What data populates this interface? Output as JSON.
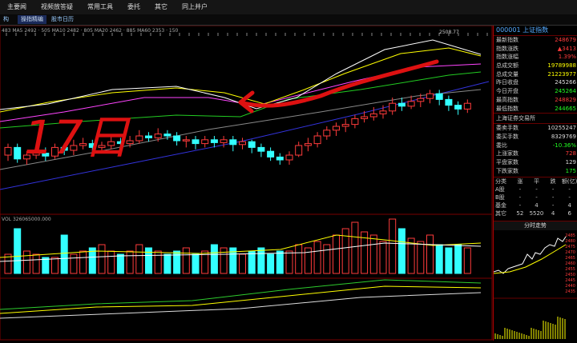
{
  "menubar": {
    "items": [
      "主要闻",
      "视频放答疑",
      "常用工具",
      "委托",
      "其它",
      "同上并户"
    ]
  },
  "tabs": [
    "构",
    "操指精编",
    "股市日历"
  ],
  "chart": {
    "ma_legend": "483 MA5 2492 · 505 MA10 2482 · 805 MA20 2462 · 885 MA60 2353 · 150",
    "price_label": "2508.77",
    "volume_legend": "VOL 326065000.000",
    "annotation": "17日",
    "candles": [
      {
        "o": 60,
        "c": 52,
        "h": 48,
        "l": 66
      },
      {
        "o": 52,
        "c": 64,
        "h": 48,
        "l": 68
      },
      {
        "o": 64,
        "c": 60,
        "h": 56,
        "l": 70
      },
      {
        "o": 60,
        "c": 58,
        "h": 54,
        "l": 64
      },
      {
        "o": 58,
        "c": 61,
        "h": 52,
        "l": 66
      },
      {
        "o": 61,
        "c": 52,
        "h": 48,
        "l": 64
      },
      {
        "o": 52,
        "c": 55,
        "h": 48,
        "l": 60
      },
      {
        "o": 55,
        "c": 50,
        "h": 44,
        "l": 60
      },
      {
        "o": 50,
        "c": 48,
        "h": 42,
        "l": 54
      },
      {
        "o": 48,
        "c": 52,
        "h": 44,
        "l": 58
      },
      {
        "o": 52,
        "c": 50,
        "h": 46,
        "l": 56
      },
      {
        "o": 50,
        "c": 46,
        "h": 40,
        "l": 54
      },
      {
        "o": 46,
        "c": 48,
        "h": 42,
        "l": 52
      },
      {
        "o": 48,
        "c": 45,
        "h": 40,
        "l": 52
      },
      {
        "o": 45,
        "c": 40,
        "h": 34,
        "l": 48
      },
      {
        "o": 40,
        "c": 42,
        "h": 36,
        "l": 46
      },
      {
        "o": 42,
        "c": 38,
        "h": 32,
        "l": 46
      },
      {
        "o": 38,
        "c": 40,
        "h": 34,
        "l": 44
      },
      {
        "o": 40,
        "c": 45,
        "h": 36,
        "l": 50
      },
      {
        "o": 45,
        "c": 44,
        "h": 40,
        "l": 52
      },
      {
        "o": 44,
        "c": 48,
        "h": 40,
        "l": 54
      },
      {
        "o": 48,
        "c": 44,
        "h": 40,
        "l": 52
      },
      {
        "o": 44,
        "c": 47,
        "h": 40,
        "l": 52
      },
      {
        "o": 47,
        "c": 44,
        "h": 40,
        "l": 52
      },
      {
        "o": 44,
        "c": 49,
        "h": 40,
        "l": 56
      },
      {
        "o": 49,
        "c": 46,
        "h": 42,
        "l": 54
      },
      {
        "o": 46,
        "c": 52,
        "h": 44,
        "l": 58
      },
      {
        "o": 52,
        "c": 56,
        "h": 48,
        "l": 62
      },
      {
        "o": 56,
        "c": 62,
        "h": 52,
        "l": 66
      },
      {
        "o": 62,
        "c": 65,
        "h": 58,
        "l": 70
      },
      {
        "o": 65,
        "c": 60,
        "h": 56,
        "l": 70
      },
      {
        "o": 60,
        "c": 50,
        "h": 46,
        "l": 62
      },
      {
        "o": 50,
        "c": 48,
        "h": 42,
        "l": 56
      },
      {
        "o": 48,
        "c": 40,
        "h": 36,
        "l": 52
      },
      {
        "o": 40,
        "c": 34,
        "h": 30,
        "l": 44
      },
      {
        "o": 34,
        "c": 30,
        "h": 26,
        "l": 40
      },
      {
        "o": 30,
        "c": 28,
        "h": 22,
        "l": 36
      },
      {
        "o": 28,
        "c": 22,
        "h": 18,
        "l": 32
      },
      {
        "o": 22,
        "c": 20,
        "h": 14,
        "l": 26
      },
      {
        "o": 20,
        "c": 17,
        "h": 10,
        "l": 24
      },
      {
        "o": 17,
        "c": 14,
        "h": 8,
        "l": 22
      },
      {
        "o": 14,
        "c": 6,
        "h": 0,
        "l": 18
      },
      {
        "o": 6,
        "c": 9,
        "h": 0,
        "l": 14
      },
      {
        "o": 9,
        "c": 4,
        "h": -2,
        "l": 12
      },
      {
        "o": 4,
        "c": 1,
        "h": -4,
        "l": 10
      },
      {
        "o": 1,
        "c": -4,
        "h": -8,
        "l": 6
      },
      {
        "o": -4,
        "c": 2,
        "h": -8,
        "l": 8
      },
      {
        "o": 2,
        "c": 8,
        "h": -2,
        "l": 14
      },
      {
        "o": 8,
        "c": 12,
        "h": 4,
        "l": 18
      },
      {
        "o": 12,
        "c": 6,
        "h": 2,
        "l": 16
      }
    ],
    "volumes": [
      6,
      14,
      7,
      6,
      5,
      5,
      12,
      6,
      7,
      8,
      9,
      7,
      6,
      7,
      9,
      8,
      7,
      6,
      7,
      8,
      6,
      7,
      9,
      8,
      8,
      6,
      7,
      8,
      6,
      7,
      7,
      9,
      8,
      10,
      9,
      12,
      14,
      16,
      13,
      12,
      10,
      17,
      14,
      11,
      10,
      12,
      9,
      8,
      9,
      8
    ]
  },
  "quote": {
    "title": "000001 上证指数",
    "rows": [
      {
        "label": "最新指数",
        "value": "248679",
        "color": "red"
      },
      {
        "label": "指数涨跌",
        "value": "▲3413",
        "color": "red"
      },
      {
        "label": "指数涨幅",
        "value": "1.39%",
        "color": "red"
      },
      {
        "label": "总成交额",
        "value": "19789988",
        "color": "yellow"
      },
      {
        "label": "总成交量",
        "value": "21223977",
        "color": "yellow"
      },
      {
        "label": "昨日收盘",
        "value": "245266",
        "color": "white"
      },
      {
        "label": "今日开盘",
        "value": "245264",
        "color": "green"
      },
      {
        "label": "最高指数",
        "value": "248829",
        "color": "red"
      },
      {
        "label": "最低指数",
        "value": "244665",
        "color": "green"
      }
    ],
    "exchange": "上海证券交易所",
    "rows2": [
      {
        "label": "委卖手数",
        "value": "10255247",
        "color": "white"
      },
      {
        "label": "委买手数",
        "value": "8329769",
        "color": "white"
      },
      {
        "label": "委比",
        "value": "-10.36%",
        "color": "green"
      },
      {
        "label": "上涨家数",
        "value": "728",
        "color": "red"
      },
      {
        "label": "平盘家数",
        "value": "129",
        "color": "white"
      },
      {
        "label": "下跌家数",
        "value": "175",
        "color": "green"
      }
    ],
    "stats_header": [
      "分类",
      "涨",
      "平",
      "跌",
      "额(亿)"
    ],
    "stats_rows": [
      [
        "A股",
        "-",
        "-",
        "-",
        "-"
      ],
      [
        "B股",
        "-",
        "-",
        "-",
        "-"
      ],
      [
        "基金",
        "-",
        "4",
        "-",
        "4"
      ],
      [
        "其它",
        "52",
        "5520",
        "4",
        "6"
      ]
    ],
    "mini_title": "分时走势",
    "mini_ticks": [
      "2485",
      "2480",
      "2475",
      "2470",
      "2465",
      "2460",
      "2455",
      "2450",
      "2445",
      "2440",
      "2435"
    ]
  },
  "colors": {
    "up": "#ff3b3b",
    "down": "#3ff",
    "ma5": "#ffffff",
    "ma10": "#ffff00",
    "ma20": "#ff44ff",
    "ma60": "#22cc22",
    "ma120": "#888888",
    "ma250": "#3333dd",
    "marker": "#dd1111"
  }
}
